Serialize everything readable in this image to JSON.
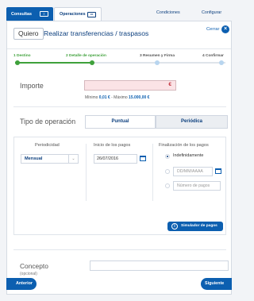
{
  "nav": {
    "consultas": "Consultas",
    "operaciones": "Operaciones",
    "condiciones": "Condiciones",
    "configurar": "Configurar"
  },
  "header": {
    "quiero": "Quiero",
    "title": "Realizar transferencias / traspasos",
    "close": "Cerrar"
  },
  "steps": [
    {
      "label": "1 Destino",
      "state": "done"
    },
    {
      "label": "2 Detalle de operación",
      "state": "current"
    },
    {
      "label": "3 Resumen y Firma",
      "state": "pending"
    },
    {
      "label": "4 Confirmar",
      "state": "pending"
    }
  ],
  "importe": {
    "label": "Importe",
    "currency": "€",
    "limits_prefix": "Mínimo",
    "min": "0,01 €",
    "limits_sep": "- Máximo",
    "max": "15.000,00 €"
  },
  "tipo": {
    "label": "Tipo de operación",
    "options": [
      "Puntual",
      "Periódica"
    ],
    "selected": "Periódica"
  },
  "periodic": {
    "periodicidad_label": "Periodicidad",
    "periodicidad_value": "Mensual",
    "inicio_label": "Inicio de los pagos",
    "inicio_value": "26/07/2016",
    "fin_label": "Finalización de los pagos",
    "fin_options": {
      "indefinido": "Indefinidamente",
      "fecha_placeholder": "DD/MM/AAAA",
      "numero_placeholder": "Número de pagos"
    },
    "fin_selected": "Indefinidamente",
    "simulador": "Simulador de pagos"
  },
  "concepto": {
    "label": "Concepto",
    "sublabel": "(opcional)",
    "value": ""
  },
  "footer": {
    "prev": "Anterior",
    "next": "Siguiente"
  },
  "colors": {
    "primary": "#0c5fb0",
    "dark": "#0c3f7e",
    "done": "#3fa13b",
    "error_bg": "#fbe3e6"
  }
}
